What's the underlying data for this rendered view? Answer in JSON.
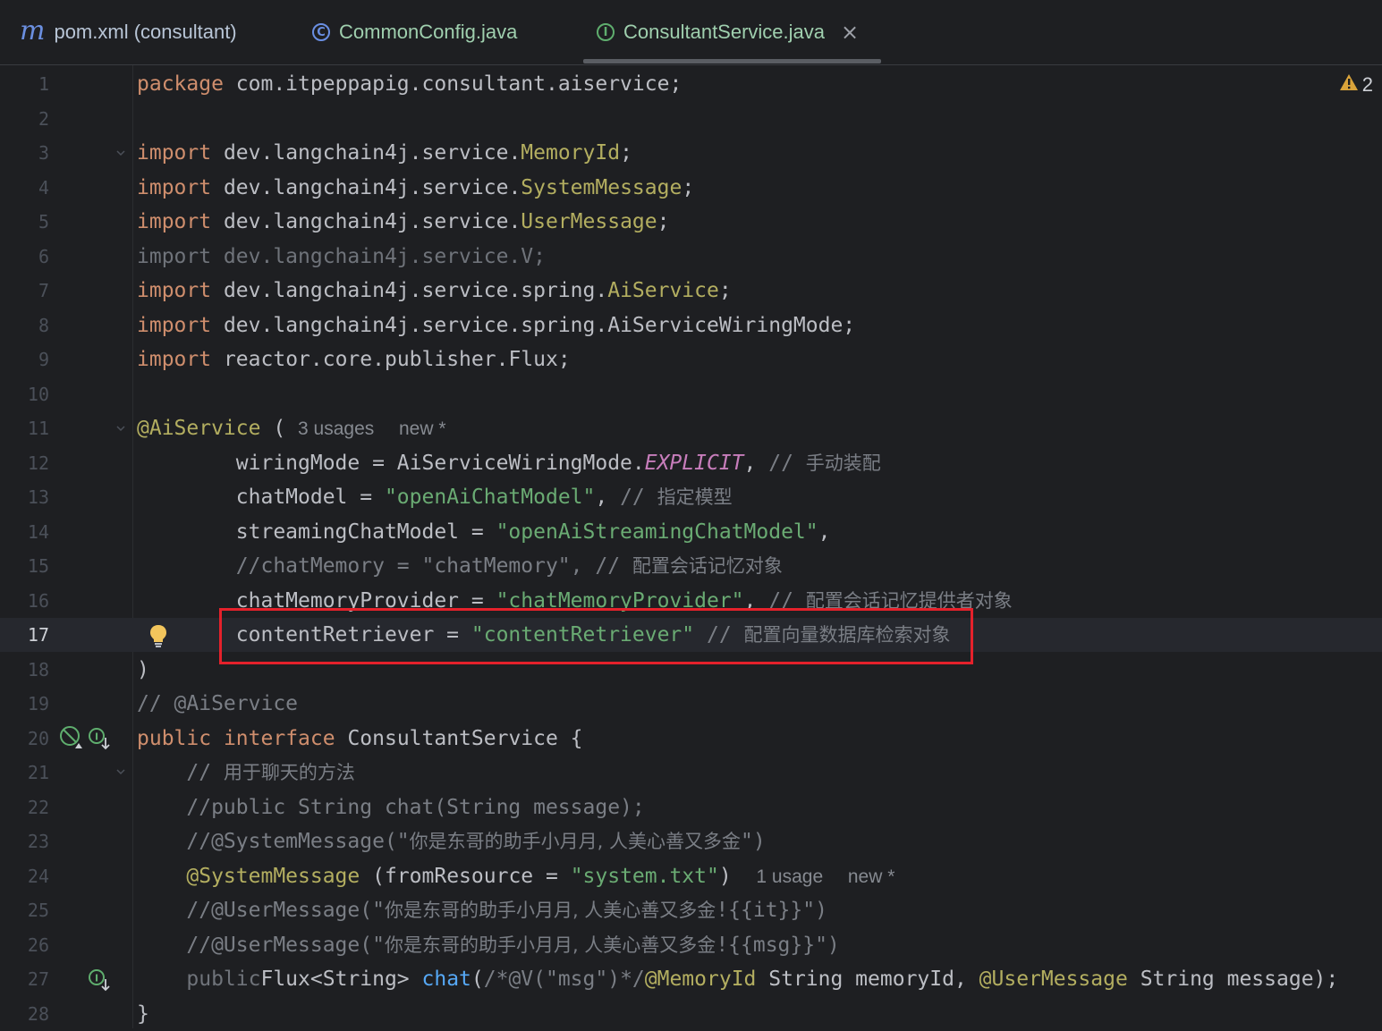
{
  "tabs": [
    {
      "label": "pom.xml (consultant)",
      "icon": "maven-icon"
    },
    {
      "label": "CommonConfig.java",
      "icon": "class-icon"
    },
    {
      "label": "ConsultantService.java",
      "icon": "interface-icon",
      "active": true,
      "close": "×"
    }
  ],
  "warnings": {
    "count": "2"
  },
  "lines": [
    {
      "n": "1",
      "t": [
        [
          "kw",
          "package"
        ],
        [
          "",
          "com.itpeppapig.consultant.aiservice;"
        ]
      ]
    },
    {
      "n": "2",
      "t": []
    },
    {
      "n": "3",
      "t": [
        [
          "kw",
          "import"
        ],
        [
          "",
          "dev.langchain4j.service."
        ],
        [
          "cls",
          "MemoryId"
        ],
        [
          "",
          ";"
        ]
      ]
    },
    {
      "n": "4",
      "t": [
        [
          "kw",
          "import"
        ],
        [
          "",
          "dev.langchain4j.service."
        ],
        [
          "cls",
          "SystemMessage"
        ],
        [
          "",
          ";"
        ]
      ]
    },
    {
      "n": "5",
      "t": [
        [
          "kw",
          "import"
        ],
        [
          "",
          "dev.langchain4j.service."
        ],
        [
          "cls",
          "UserMessage"
        ],
        [
          "",
          ";"
        ]
      ]
    },
    {
      "n": "6",
      "t": [
        [
          "unused",
          "import dev.langchain4j.service.V;"
        ]
      ]
    },
    {
      "n": "7",
      "t": [
        [
          "kw",
          "import"
        ],
        [
          "",
          "dev.langchain4j.service.spring."
        ],
        [
          "cls",
          "AiService"
        ],
        [
          "",
          ";"
        ]
      ]
    },
    {
      "n": "8",
      "t": [
        [
          "kw",
          "import"
        ],
        [
          "",
          "dev.langchain4j.service.spring.AiServiceWiringMode;"
        ]
      ]
    },
    {
      "n": "9",
      "t": [
        [
          "kw",
          "import"
        ],
        [
          "",
          "reactor.core.publisher.Flux;"
        ]
      ]
    },
    {
      "n": "10",
      "t": []
    },
    {
      "n": "11",
      "t": [
        [
          "an",
          "@AiService"
        ],
        [
          "",
          "( "
        ],
        [
          "hint",
          "3 usages"
        ],
        [
          "",
          "  "
        ],
        [
          "hint",
          "new *"
        ]
      ]
    },
    {
      "n": "12",
      "t": [
        [
          "",
          "        wiringMode = AiServiceWiringMode."
        ],
        [
          "const",
          "EXPLICIT"
        ],
        [
          "",
          ", "
        ],
        [
          "cm",
          "// "
        ],
        [
          "cmz",
          "手动装配"
        ]
      ]
    },
    {
      "n": "13",
      "t": [
        [
          "",
          "        chatModel = "
        ],
        [
          "str",
          "\"openAiChatModel\""
        ],
        [
          "",
          ", "
        ],
        [
          "cm",
          "// "
        ],
        [
          "cmz",
          "指定模型"
        ]
      ]
    },
    {
      "n": "14",
      "t": [
        [
          "",
          "        streamingChatModel = "
        ],
        [
          "str",
          "\"openAiStreamingChatModel\""
        ],
        [
          "",
          ","
        ]
      ]
    },
    {
      "n": "15",
      "t": [
        [
          "cm",
          "        //chatMemory = \"chatMemory\", // "
        ],
        [
          "cmz",
          "配置会话记忆对象"
        ]
      ]
    },
    {
      "n": "16",
      "t": [
        [
          "",
          "        chatMemoryProvider = "
        ],
        [
          "str",
          "\"chatMemoryProvider\""
        ],
        [
          "",
          ", "
        ],
        [
          "cm",
          "// "
        ],
        [
          "cmz",
          "配置会话记忆提供者对象"
        ]
      ]
    },
    {
      "n": "17",
      "t": [
        [
          "",
          "        contentRetriever = "
        ],
        [
          "str",
          "\"contentRetriever\""
        ],
        [
          "cm",
          " // "
        ],
        [
          "cmz",
          "配置向量数据库检索对象"
        ]
      ],
      "current": true
    },
    {
      "n": "18",
      "t": [
        [
          "",
          ")"
        ]
      ]
    },
    {
      "n": "19",
      "t": [
        [
          "cm",
          "// @AiService"
        ]
      ]
    },
    {
      "n": "20",
      "t": [
        [
          "kw",
          "public"
        ],
        [
          "",
          ""
        ],
        [
          "kw",
          "interface"
        ],
        [
          "",
          "ConsultantService {"
        ]
      ]
    },
    {
      "n": "21",
      "t": [
        [
          "cm",
          "    // "
        ],
        [
          "cmz",
          "用于聊天的方法"
        ]
      ]
    },
    {
      "n": "22",
      "t": [
        [
          "cm",
          "    //public String chat(String message);"
        ]
      ]
    },
    {
      "n": "23",
      "t": [
        [
          "cm",
          "    //@SystemMessage(\""
        ],
        [
          "cmz",
          "你是东哥的助手小月月, 人美心善又多金"
        ],
        [
          "cm",
          "\")"
        ]
      ]
    },
    {
      "n": "24",
      "t": [
        [
          "",
          "    "
        ],
        [
          "an",
          "@SystemMessage"
        ],
        [
          "",
          "(fromResource = "
        ],
        [
          "str",
          "\"system.txt\""
        ],
        [
          "",
          ")  "
        ],
        [
          "hint",
          "1 usage"
        ],
        [
          "",
          "  "
        ],
        [
          "hint",
          "new *"
        ]
      ]
    },
    {
      "n": "25",
      "t": [
        [
          "cm",
          "    //@UserMessage(\""
        ],
        [
          "cmz",
          "你是东哥的助手小月月, 人美心善又多金"
        ],
        [
          "cm",
          "!{{it}}\")"
        ]
      ]
    },
    {
      "n": "26",
      "t": [
        [
          "cm",
          "    //@UserMessage(\""
        ],
        [
          "cmz",
          "你是东哥的助手小月月, 人美心善又多金"
        ],
        [
          "cm",
          "!{{msg}}\")"
        ]
      ]
    },
    {
      "n": "27",
      "t": [
        [
          "",
          "    "
        ],
        [
          "unused",
          "public"
        ],
        [
          "",
          "Flux<String> "
        ],
        [
          "fn",
          "chat"
        ],
        [
          "",
          "("
        ],
        [
          "cm",
          "/*@V(\"msg\")*/"
        ],
        [
          "an",
          "@MemoryId"
        ],
        [
          "",
          "String memoryId, "
        ],
        [
          "an",
          "@UserMessage"
        ],
        [
          "",
          "String message);"
        ]
      ]
    },
    {
      "n": "28",
      "t": [
        [
          "",
          "}"
        ]
      ]
    }
  ]
}
